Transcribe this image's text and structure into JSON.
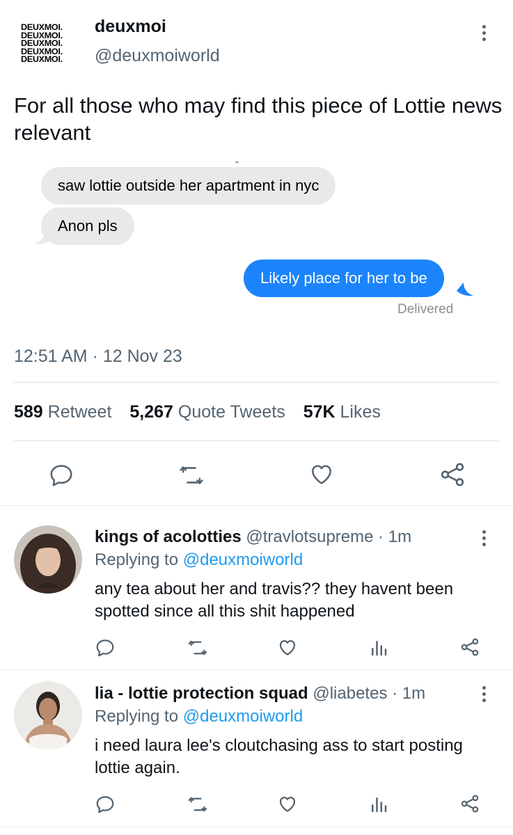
{
  "tweet": {
    "logo_lines": [
      "DEUXMOI.",
      "DEUXMOI.",
      "DEUXMOI.",
      "DEUXMOI.",
      "DEUXMOI."
    ],
    "author_name": "deuxmoi",
    "author_handle": "@deuxmoiworld",
    "text": "For all those who may find this piece of Lottie news relevant",
    "imessage": {
      "incoming": [
        "saw lottie outside her apartment in nyc",
        "Anon pls"
      ],
      "outgoing": "Likely place for her to be",
      "status": "Delivered"
    },
    "timestamp": "12:51 AM · 12 Nov 23",
    "stats": {
      "retweets": "589",
      "retweets_label": "Retweet",
      "quotes": "5,267",
      "quotes_label": "Quote Tweets",
      "likes": "57K",
      "likes_label": "Likes"
    }
  },
  "icons": {
    "reply": "comment-bubble-icon",
    "retweet": "retweet-icon",
    "like": "heart-icon",
    "share": "share-icon",
    "analytics": "bar-chart-icon",
    "more": "more-dots-icon"
  },
  "colors": {
    "link": "#1d9bf0",
    "imessage_blue": "#1b84fb",
    "imessage_gray": "#e9e9eb"
  },
  "replies": [
    {
      "name": "kings of acolotties",
      "handle": "@travlotsupreme",
      "time": "· 1m",
      "replying_label": "Replying to",
      "replying_handle": "@deuxmoiworld",
      "text": "any tea about her and travis?? they havent been spotted since all this shit happened"
    },
    {
      "name": "lia - lottie protection squad",
      "handle": "@liabetes",
      "time": "· 1m",
      "replying_label": "Replying to",
      "replying_handle": "@deuxmoiworld",
      "text": "i need laura lee's cloutchasing ass to start posting lottie again."
    }
  ]
}
